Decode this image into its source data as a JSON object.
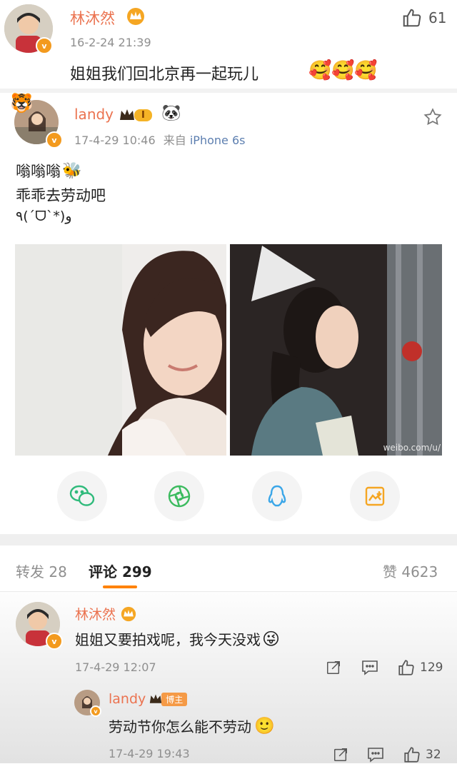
{
  "top_comment": {
    "username": "林沐然",
    "time": "16-2-24 21:39",
    "text": "姐姐我们回北京再一起玩儿",
    "likes": "61"
  },
  "post": {
    "username": "landy",
    "level": "I",
    "time": "17-4-29 10:46",
    "source_prefix": "来自",
    "source_device": "iPhone 6s",
    "lines": [
      "嗡嗡嗡",
      "乖乖去劳动吧",
      "٩(ˊᗜˋ*)و"
    ],
    "watermark": "weibo.com/u/"
  },
  "tabs": {
    "repost": "转发 28",
    "comment": "评论 299",
    "like": "赞 4623"
  },
  "comments": [
    {
      "username": "林沐然",
      "text": "姐姐又要拍戏呢，我今天没戏",
      "time": "17-4-29 12:07",
      "likes": "129"
    }
  ],
  "reply": {
    "username": "landy",
    "badge": "博主",
    "text": "劳动节你怎么能不劳动",
    "time": "17-4-29 19:43",
    "likes": "32"
  },
  "colors": {
    "username": "#eb7350",
    "accent_tab": "#ff8200",
    "verified": "#f39a1e"
  }
}
